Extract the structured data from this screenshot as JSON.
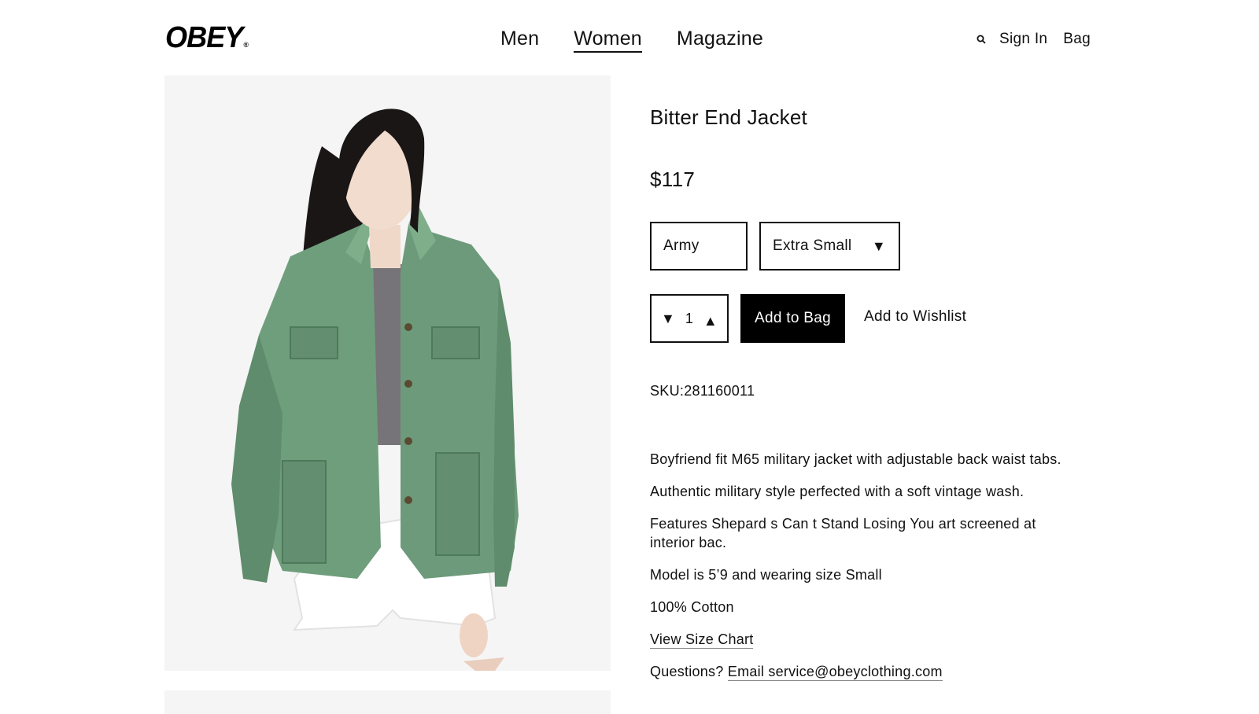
{
  "header": {
    "logo": "OBEY",
    "logo_mark": "®",
    "nav": [
      "Men",
      "Women",
      "Magazine"
    ],
    "active_nav": "Women",
    "sign_in": "Sign In",
    "bag": "Bag",
    "search_icon": "search-icon"
  },
  "product": {
    "title": "Bitter End Jacket",
    "price": "$117",
    "color": "Army",
    "size": "Extra Small",
    "quantity": "1",
    "add_to_bag": "Add to Bag",
    "add_to_wishlist": "Add to Wishlist",
    "sku_label": "SKU:",
    "sku_value": "281160011",
    "description": [
      "Boyfriend fit M65 military jacket with adjustable back waist tabs.",
      "Authentic military style perfected with a soft vintage wash.",
      "Features Shepard s Can t Stand Losing You art screened at interior bac.",
      "Model is 5’9 and wearing size Small",
      "100% Cotton"
    ],
    "size_chart_link": "View Size Chart",
    "questions_label": "Questions?",
    "email_link": "Email service@obeyclothing.com"
  },
  "colors": {
    "accent": "#000000",
    "jacket_green": "#6f9e7c",
    "gallery_bg": "#f5f5f5"
  }
}
